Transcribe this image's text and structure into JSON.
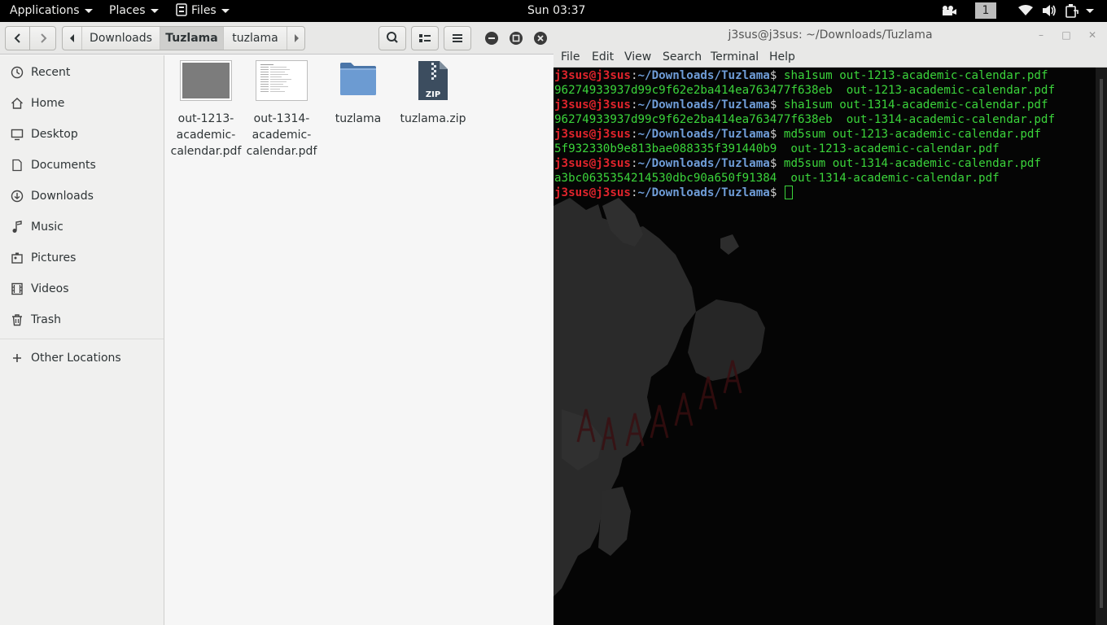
{
  "topbar": {
    "applications": "Applications",
    "places": "Places",
    "files": "Files",
    "clock": "Sun 03:37",
    "workspace": "1"
  },
  "files_window": {
    "path": [
      "Downloads",
      "Tuzlama",
      "tuzlama"
    ],
    "sidebar": [
      {
        "label": "Recent",
        "icon": "recent-icon"
      },
      {
        "label": "Home",
        "icon": "home-icon"
      },
      {
        "label": "Desktop",
        "icon": "desktop-icon"
      },
      {
        "label": "Documents",
        "icon": "documents-icon"
      },
      {
        "label": "Downloads",
        "icon": "downloads-icon"
      },
      {
        "label": "Music",
        "icon": "music-icon"
      },
      {
        "label": "Pictures",
        "icon": "pictures-icon"
      },
      {
        "label": "Videos",
        "icon": "videos-icon"
      },
      {
        "label": "Trash",
        "icon": "trash-icon"
      },
      {
        "label": "Other Locations",
        "icon": "plus-icon"
      }
    ],
    "items": [
      {
        "name": "out-1213-academic-calendar.pdf",
        "lines": [
          "out-1213-",
          "academic-",
          "calendar.pdf"
        ],
        "type": "pdf-thumbnail-gray"
      },
      {
        "name": "out-1314-academic-calendar.pdf",
        "lines": [
          "out-1314-",
          "academic-",
          "calendar.pdf"
        ],
        "type": "pdf-thumbnail-doc"
      },
      {
        "name": "tuzlama",
        "lines": [
          "tuzlama"
        ],
        "type": "folder"
      },
      {
        "name": "tuzlama.zip",
        "lines": [
          "tuzlama.zip"
        ],
        "type": "zip"
      }
    ]
  },
  "terminal": {
    "title": "j3sus@j3sus: ~/Downloads/Tuzlama",
    "menu": [
      "File",
      "Edit",
      "View",
      "Search",
      "Terminal",
      "Help"
    ],
    "prompt_user": "j3sus@j3sus",
    "prompt_path": "~/Downloads/Tuzlama",
    "prompt_symbol": "$",
    "lines": [
      {
        "kind": "cmd",
        "text": "sha1sum out-1213-academic-calendar.pdf"
      },
      {
        "kind": "out",
        "text": "96274933937d99c9f62e2ba414ea763477f638eb  out-1213-academic-calendar.pdf"
      },
      {
        "kind": "cmd",
        "text": "sha1sum out-1314-academic-calendar.pdf"
      },
      {
        "kind": "out",
        "text": "96274933937d99c9f62e2ba414ea763477f638eb  out-1314-academic-calendar.pdf"
      },
      {
        "kind": "cmd",
        "text": "md5sum out-1213-academic-calendar.pdf"
      },
      {
        "kind": "out",
        "text": "5f932330b9e813bae088335f391440b9  out-1213-academic-calendar.pdf"
      },
      {
        "kind": "cmd",
        "text": "md5sum out-1314-academic-calendar.pdf"
      },
      {
        "kind": "out",
        "text": "a3bc0635354214530dbc90a650f91384  out-1314-academic-calendar.pdf"
      },
      {
        "kind": "cmd",
        "text": ""
      }
    ]
  },
  "colors": {
    "prompt_user": "#e0242c",
    "prompt_path": "#6f9dd8",
    "command": "#3bd43b",
    "terminal_bg": "#050505"
  }
}
